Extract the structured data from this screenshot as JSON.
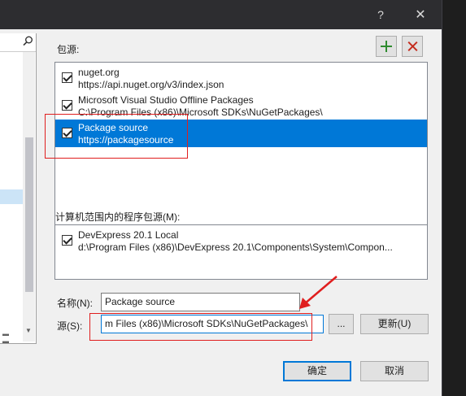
{
  "titlebar": {
    "help_glyph": "?",
    "close_glyph": "✕"
  },
  "package_sources": {
    "label": "包源:",
    "items": [
      {
        "name": "nuget.org",
        "url": "https://api.nuget.org/v3/index.json",
        "checked": true,
        "selected": false
      },
      {
        "name": "Microsoft Visual Studio Offline Packages",
        "url": "C:\\Program Files (x86)\\Microsoft SDKs\\NuGetPackages\\",
        "checked": true,
        "selected": false
      },
      {
        "name": "Package source",
        "url": "https://packagesource",
        "checked": true,
        "selected": true
      }
    ]
  },
  "machine_sources": {
    "label": "计算机范围内的程序包源(M):",
    "items": [
      {
        "name": "DevExpress 20.1 Local",
        "url": "d:\\Program Files (x86)\\DevExpress 20.1\\Components\\System\\Compon...",
        "checked": true
      }
    ]
  },
  "form": {
    "name_label": "名称(N):",
    "name_value": "Package source",
    "source_label": "源(S):",
    "source_value": "m Files (x86)\\Microsoft SDKs\\NuGetPackages\\",
    "browse_label": "...",
    "update_label": "更新(U)"
  },
  "buttons": {
    "ok": "确定",
    "cancel": "取消"
  },
  "icons": {
    "add": "plus-icon",
    "remove": "x-icon",
    "search": "search-icon"
  },
  "colors": {
    "selection": "#0078d7",
    "annotation": "#e01e1e"
  }
}
